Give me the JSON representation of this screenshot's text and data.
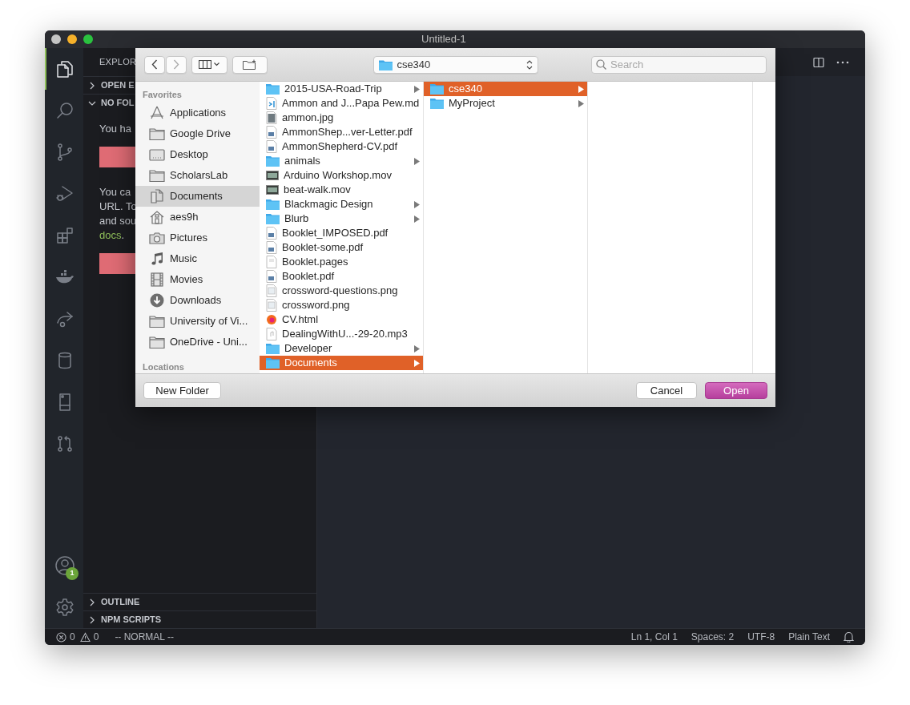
{
  "window": {
    "title": "Untitled-1"
  },
  "activity_bar": {
    "top": [
      {
        "selected": true
      },
      {
        "selected": false
      },
      {
        "selected": false
      },
      {
        "selected": false
      },
      {
        "selected": false
      },
      {
        "selected": false
      },
      {
        "selected": false
      },
      {
        "selected": false
      },
      {
        "selected": false
      },
      {
        "selected": false
      }
    ],
    "bottom": [
      {
        "selected": false,
        "badge": "1"
      },
      {
        "selected": false
      }
    ]
  },
  "sidebar": {
    "title": "EXPLOR",
    "sections": [
      {
        "label": "OPEN E",
        "expanded": false
      },
      {
        "label": "NO FOL",
        "expanded": true
      }
    ],
    "welcome": [
      {
        "kind": "text",
        "lines": [
          "You ha"
        ]
      },
      {
        "kind": "button"
      },
      {
        "kind": "text",
        "lines": [
          "You ca",
          "URL. To",
          "and sou"
        ],
        "link": "docs",
        "after": "."
      },
      {
        "kind": "button"
      }
    ],
    "bottom_sections": [
      {
        "label": "OUTLINE",
        "expanded": false
      },
      {
        "label": "NPM SCRIPTS",
        "expanded": false
      }
    ]
  },
  "dialog": {
    "path": "cse340",
    "search": {
      "placeholder": "Search"
    },
    "sidebar": [
      {
        "title": "Favorites",
        "items": [
          {
            "label": "Applications",
            "kind": "apps",
            "selected": false
          },
          {
            "label": "Google Drive",
            "kind": "folder",
            "selected": false
          },
          {
            "label": "Desktop",
            "kind": "desktop",
            "selected": false
          },
          {
            "label": "ScholarsLab",
            "kind": "folder",
            "selected": false
          },
          {
            "label": "Documents",
            "kind": "documents",
            "selected": true
          },
          {
            "label": "aes9h",
            "kind": "home",
            "selected": false
          },
          {
            "label": "Pictures",
            "kind": "camera",
            "selected": false
          },
          {
            "label": "Music",
            "kind": "music",
            "selected": false
          },
          {
            "label": "Movies",
            "kind": "film",
            "selected": false
          },
          {
            "label": "Downloads",
            "kind": "download",
            "selected": false
          },
          {
            "label": "University of Vi...",
            "kind": "folder",
            "selected": false
          },
          {
            "label": "OneDrive - Uni...",
            "kind": "folder",
            "selected": false
          }
        ]
      },
      {
        "title": "Locations"
      }
    ],
    "columns": [
      [
        {
          "name": "2015-USA-Road-Trip",
          "kind": "folder",
          "selected": false
        },
        {
          "name": "Ammon and J...Papa Pew.md",
          "kind": "code",
          "selected": false
        },
        {
          "name": "ammon.jpg",
          "kind": "photo",
          "selected": false
        },
        {
          "name": "AmmonShep...ver-Letter.pdf",
          "kind": "pdf",
          "selected": false
        },
        {
          "name": "AmmonShepherd-CV.pdf",
          "kind": "pdf",
          "selected": false
        },
        {
          "name": "animals",
          "kind": "folder",
          "selected": false
        },
        {
          "name": "Arduino Workshop.mov",
          "kind": "video",
          "selected": false
        },
        {
          "name": "beat-walk.mov",
          "kind": "video",
          "selected": false
        },
        {
          "name": "Blackmagic Design",
          "kind": "folder",
          "selected": false
        },
        {
          "name": "Blurb",
          "kind": "folder",
          "selected": false
        },
        {
          "name": "Booklet_IMPOSED.pdf",
          "kind": "pdf",
          "selected": false
        },
        {
          "name": "Booklet-some.pdf",
          "kind": "pdf",
          "selected": false
        },
        {
          "name": "Booklet.pages",
          "kind": "pages",
          "selected": false
        },
        {
          "name": "Booklet.pdf",
          "kind": "pdf",
          "selected": false
        },
        {
          "name": "crossword-questions.png",
          "kind": "image",
          "selected": false
        },
        {
          "name": "crossword.png",
          "kind": "image",
          "selected": false
        },
        {
          "name": "CV.html",
          "kind": "html",
          "selected": false
        },
        {
          "name": "DealingWithU...-29-20.mp3",
          "kind": "audio",
          "selected": false
        },
        {
          "name": "Developer",
          "kind": "folder",
          "selected": false
        },
        {
          "name": "Documents",
          "kind": "folder",
          "selected": true
        }
      ],
      [
        {
          "name": "cse340",
          "kind": "folder",
          "selected": true
        },
        {
          "name": "MyProject",
          "kind": "folder",
          "selected": false
        }
      ],
      []
    ],
    "buttons": [
      {
        "label": "New Folder",
        "kind": "secondary"
      },
      {
        "label": "Cancel",
        "kind": "secondary"
      },
      {
        "label": "Open",
        "kind": "primary"
      }
    ]
  },
  "status_bar": {
    "problems": [
      {
        "kind": "errors",
        "count": "0"
      },
      {
        "kind": "warnings",
        "count": "0"
      }
    ],
    "mode": "-- NORMAL --",
    "right": [
      "Ln 1, Col 1",
      "Spaces: 2",
      "UTF-8",
      "Plain Text"
    ]
  }
}
